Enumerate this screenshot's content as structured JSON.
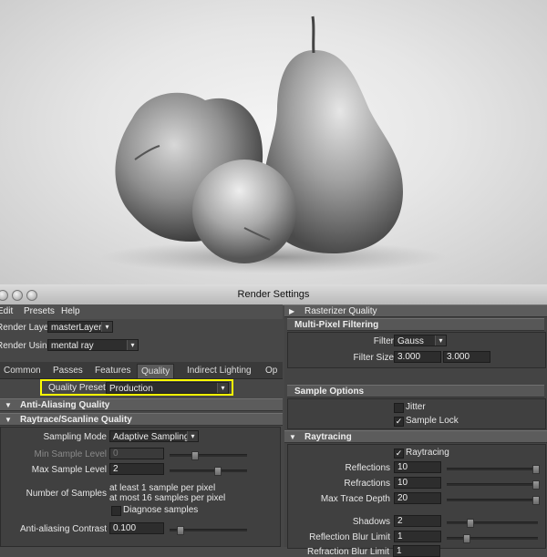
{
  "window": {
    "title": "Render Settings"
  },
  "menu": {
    "items": [
      "Edit",
      "Presets",
      "Help"
    ]
  },
  "render_layer": {
    "label": "Render Layer",
    "value": "masterLayer"
  },
  "render_using": {
    "label": "Render Using",
    "value": "mental ray"
  },
  "tabs": [
    "Common",
    "Passes",
    "Features",
    "Quality",
    "Indirect Lighting",
    "Op"
  ],
  "active_tab": "Quality",
  "quality_presets": {
    "label": "Quality Presets",
    "value": "Production",
    "highlight_color": "#ffff00"
  },
  "sections": {
    "anti_aliasing": "Anti-Aliasing Quality",
    "raytrace_scanline": "Raytrace/Scanline Quality",
    "rasterizer": "Rasterizer Quality",
    "multi_pixel": "Multi-Pixel Filtering",
    "sample_options": "Sample Options",
    "raytracing": "Raytracing"
  },
  "sampling": {
    "mode_label": "Sampling Mode",
    "mode_value": "Adaptive Sampling",
    "min_label": "Min Sample Level",
    "min_value": "0",
    "max_label": "Max Sample Level",
    "max_value": "2",
    "num_label": "Number of Samples",
    "num_line1": "at least 1 sample per pixel",
    "num_line2": "at most 16 samples per pixel",
    "diagnose_label": "Diagnose samples",
    "contrast_label": "Anti-aliasing Contrast",
    "contrast_value": "0.100"
  },
  "filter": {
    "label": "Filter",
    "value": "Gauss",
    "size_label": "Filter Size",
    "size_x": "3.000",
    "size_y": "3.000"
  },
  "sample_opts": {
    "jitter_label": "Jitter",
    "jitter_checked": false,
    "lock_label": "Sample Lock",
    "lock_checked": true
  },
  "raytracing": {
    "enable_label": "Raytracing",
    "enable_checked": true,
    "reflections_label": "Reflections",
    "reflections_value": "10",
    "refractions_label": "Refractions",
    "refractions_value": "10",
    "max_depth_label": "Max Trace Depth",
    "max_depth_value": "20",
    "shadows_label": "Shadows",
    "shadows_value": "2",
    "refl_blur_label": "Reflection Blur Limit",
    "refl_blur_value": "1",
    "refr_blur_label": "Refraction Blur Limit",
    "refr_blur_value": "1"
  },
  "icons": {
    "expanded": "triangle-down",
    "collapsed": "triangle-right",
    "check": "check-mark",
    "dropdown": "dropdown-arrow"
  }
}
